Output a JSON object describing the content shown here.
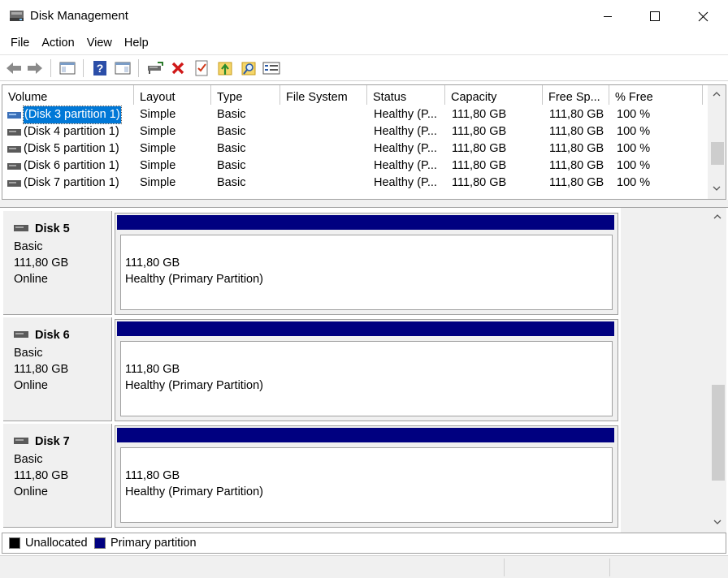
{
  "window": {
    "title": "Disk Management",
    "icon": "disk-management-icon"
  },
  "menu": [
    "File",
    "Action",
    "View",
    "Help"
  ],
  "toolbar": {
    "buttons": [
      "back-arrow-icon",
      "forward-arrow-icon",
      "show-hide-console-tree-icon",
      "help-icon",
      "show-hide-action-pane-icon",
      "connect-disk-icon",
      "delete-icon",
      "properties-checkmark-icon",
      "export-list-icon",
      "search-folder-icon",
      "view-settings-icon"
    ]
  },
  "volume_list": {
    "columns": [
      "Volume",
      "Layout",
      "Type",
      "File System",
      "Status",
      "Capacity",
      "Free Sp...",
      "% Free"
    ],
    "rows": [
      {
        "volume": "(Disk 3 partition 1)",
        "layout": "Simple",
        "type": "Basic",
        "fs": "",
        "status": "Healthy (P...",
        "capacity": "111,80 GB",
        "free": "111,80 GB",
        "pct": "100 %",
        "selected": true
      },
      {
        "volume": "(Disk 4 partition 1)",
        "layout": "Simple",
        "type": "Basic",
        "fs": "",
        "status": "Healthy (P...",
        "capacity": "111,80 GB",
        "free": "111,80 GB",
        "pct": "100 %"
      },
      {
        "volume": "(Disk 5 partition 1)",
        "layout": "Simple",
        "type": "Basic",
        "fs": "",
        "status": "Healthy (P...",
        "capacity": "111,80 GB",
        "free": "111,80 GB",
        "pct": "100 %"
      },
      {
        "volume": "(Disk 6 partition 1)",
        "layout": "Simple",
        "type": "Basic",
        "fs": "",
        "status": "Healthy (P...",
        "capacity": "111,80 GB",
        "free": "111,80 GB",
        "pct": "100 %"
      },
      {
        "volume": "(Disk 7 partition 1)",
        "layout": "Simple",
        "type": "Basic",
        "fs": "",
        "status": "Healthy (P...",
        "capacity": "111,80 GB",
        "free": "111,80 GB",
        "pct": "100 %"
      }
    ]
  },
  "disks": [
    {
      "name": "Disk 5",
      "type": "Basic",
      "size": "111,80 GB",
      "state": "Online",
      "partition_size": "111,80 GB",
      "partition_status": "Healthy (Primary Partition)"
    },
    {
      "name": "Disk 6",
      "type": "Basic",
      "size": "111,80 GB",
      "state": "Online",
      "partition_size": "111,80 GB",
      "partition_status": "Healthy (Primary Partition)"
    },
    {
      "name": "Disk 7",
      "type": "Basic",
      "size": "111,80 GB",
      "state": "Online",
      "partition_size": "111,80 GB",
      "partition_status": "Healthy (Primary Partition)"
    }
  ],
  "legend": [
    {
      "label": "Unallocated",
      "color": "#000000"
    },
    {
      "label": "Primary partition",
      "color": "#000080"
    }
  ],
  "colors": {
    "primary_partition": "#000080",
    "selection": "#0078d7"
  }
}
